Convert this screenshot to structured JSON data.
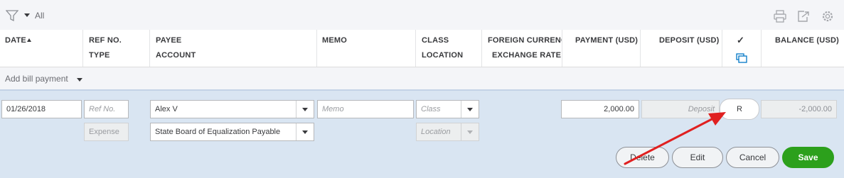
{
  "toolbar": {
    "filter_label": "All"
  },
  "columns": {
    "date": "DATE",
    "ref_no": "REF NO.",
    "type": "TYPE",
    "payee": "PAYEE",
    "account": "ACCOUNT",
    "memo": "MEMO",
    "class": "CLASS",
    "location": "LOCATION",
    "foreign_currency": "FOREIGN CURRENC",
    "exchange_rate": "EXCHANGE RATE",
    "payment": "PAYMENT (USD)",
    "deposit": "DEPOSIT (USD)",
    "check": "✓",
    "balance": "BALANCE (USD)"
  },
  "add_row": {
    "label": "Add bill payment"
  },
  "edit_row": {
    "date": "01/26/2018",
    "ref_no_placeholder": "Ref No.",
    "type": "Expense",
    "payee": "Alex V",
    "account": "State Board of Equalization Payable",
    "memo_placeholder": "Memo",
    "class_placeholder": "Class",
    "location_placeholder": "Location",
    "payment": "2,000.00",
    "deposit_placeholder": "Deposit",
    "reconcile_status": "R",
    "balance": "-2,000.00"
  },
  "actions": {
    "delete": "Delete",
    "edit": "Edit",
    "cancel": "Cancel",
    "save": "Save"
  },
  "colors": {
    "save_green": "#2ca01c",
    "annotation_arrow": "#e02020",
    "row_highlight": "#d9e5f2"
  }
}
